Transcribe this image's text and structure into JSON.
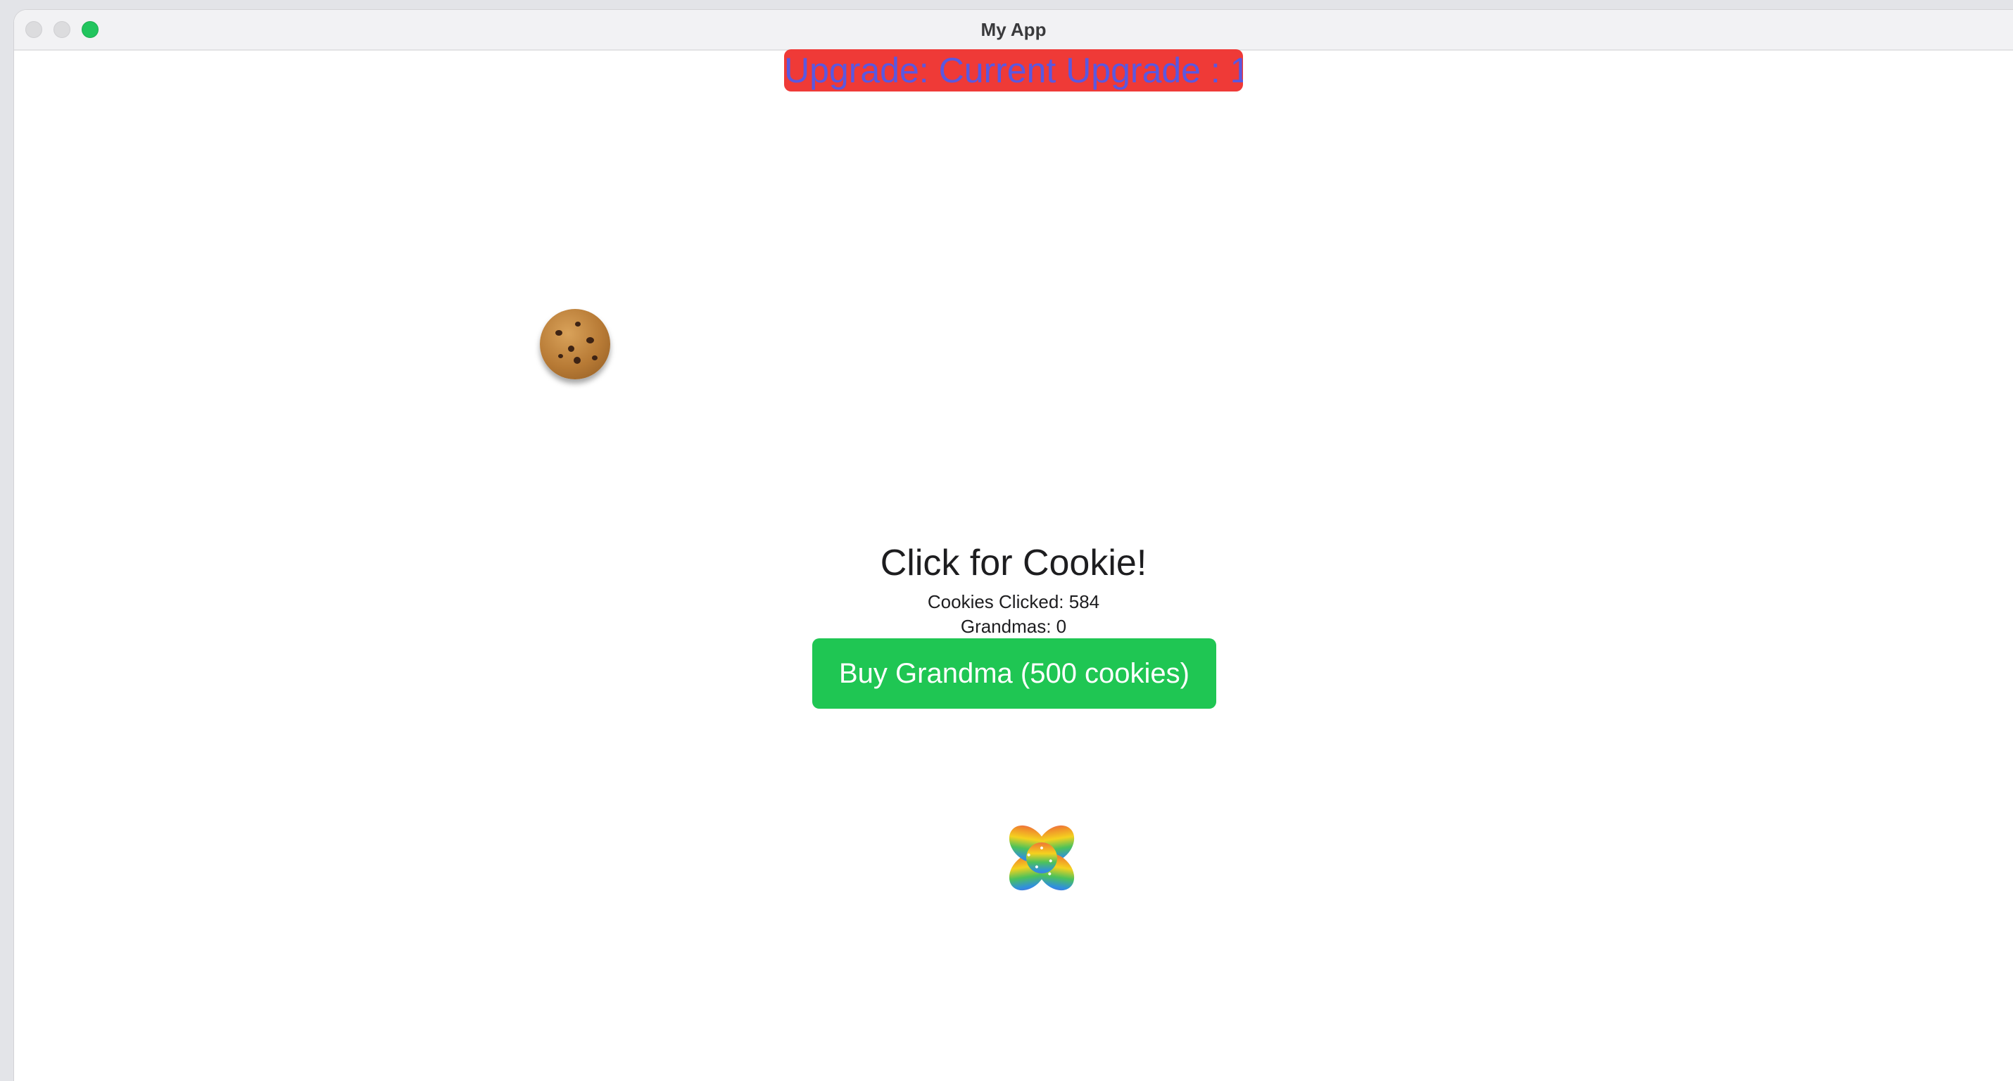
{
  "window": {
    "title": "My App"
  },
  "upgrade": {
    "label": "Upgrade: Current Upgrade : 1"
  },
  "game": {
    "title": "Click for Cookie!",
    "cookies_clicked": "Cookies Clicked: 584",
    "grandmas": "Grandmas: 0",
    "buy_grandma_label": "Buy Grandma (500 cookies)"
  },
  "icons": {
    "cookie": "cookie-icon",
    "rainbow_cookie": "rainbow-cookie-icon"
  },
  "colors": {
    "upgrade_bg": "#ef3a37",
    "upgrade_text": "#5a58e0",
    "buy_button_bg": "#1fc653",
    "traffic_zoom": "#22c55e"
  }
}
